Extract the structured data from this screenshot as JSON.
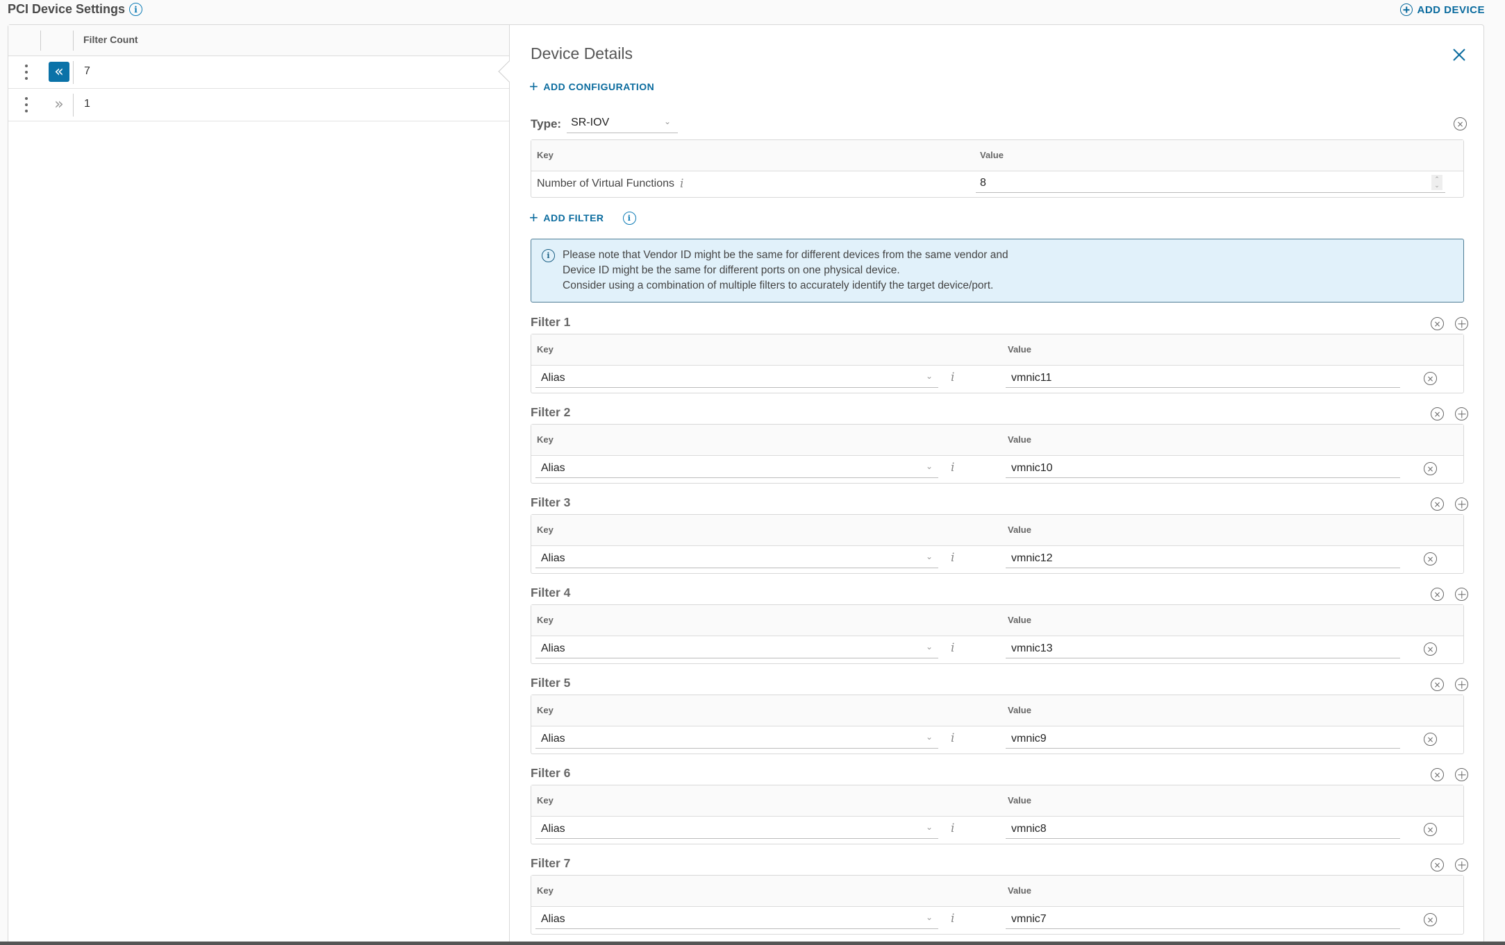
{
  "header": {
    "title": "PCI Device Settings",
    "add_device_label": "ADD DEVICE"
  },
  "grid": {
    "columns": [
      "Filter Count"
    ],
    "rows": [
      {
        "filter_count": "7",
        "expanded": true
      },
      {
        "filter_count": "1",
        "expanded": false
      }
    ]
  },
  "details": {
    "title": "Device Details",
    "add_configuration_label": "ADD CONFIGURATION",
    "type_label": "Type:",
    "type_value": "SR-IOV",
    "config_table": {
      "key_header": "Key",
      "value_header": "Value",
      "key": "Number of Virtual Functions",
      "value": "8"
    },
    "add_filter_label": "ADD FILTER",
    "banner_lines": [
      "Please note that Vendor ID might be the same for different devices from the same vendor and",
      "Device ID might be the same for different ports on one physical device.",
      "Consider using a combination of multiple filters to accurately identify the target device/port."
    ],
    "filter_key_header": "Key",
    "filter_value_header": "Value",
    "filters": [
      {
        "label": "Filter 1",
        "key": "Alias",
        "value": "vmnic11"
      },
      {
        "label": "Filter 2",
        "key": "Alias",
        "value": "vmnic10"
      },
      {
        "label": "Filter 3",
        "key": "Alias",
        "value": "vmnic12"
      },
      {
        "label": "Filter 4",
        "key": "Alias",
        "value": "vmnic13"
      },
      {
        "label": "Filter 5",
        "key": "Alias",
        "value": "vmnic9"
      },
      {
        "label": "Filter 6",
        "key": "Alias",
        "value": "vmnic8"
      },
      {
        "label": "Filter 7",
        "key": "Alias",
        "value": "vmnic7"
      }
    ]
  },
  "colors": {
    "accent": "#0a6b9e",
    "active_expander": "#0a72a8",
    "banner_bg": "#e1f1fa",
    "banner_border": "#4c7b95"
  }
}
